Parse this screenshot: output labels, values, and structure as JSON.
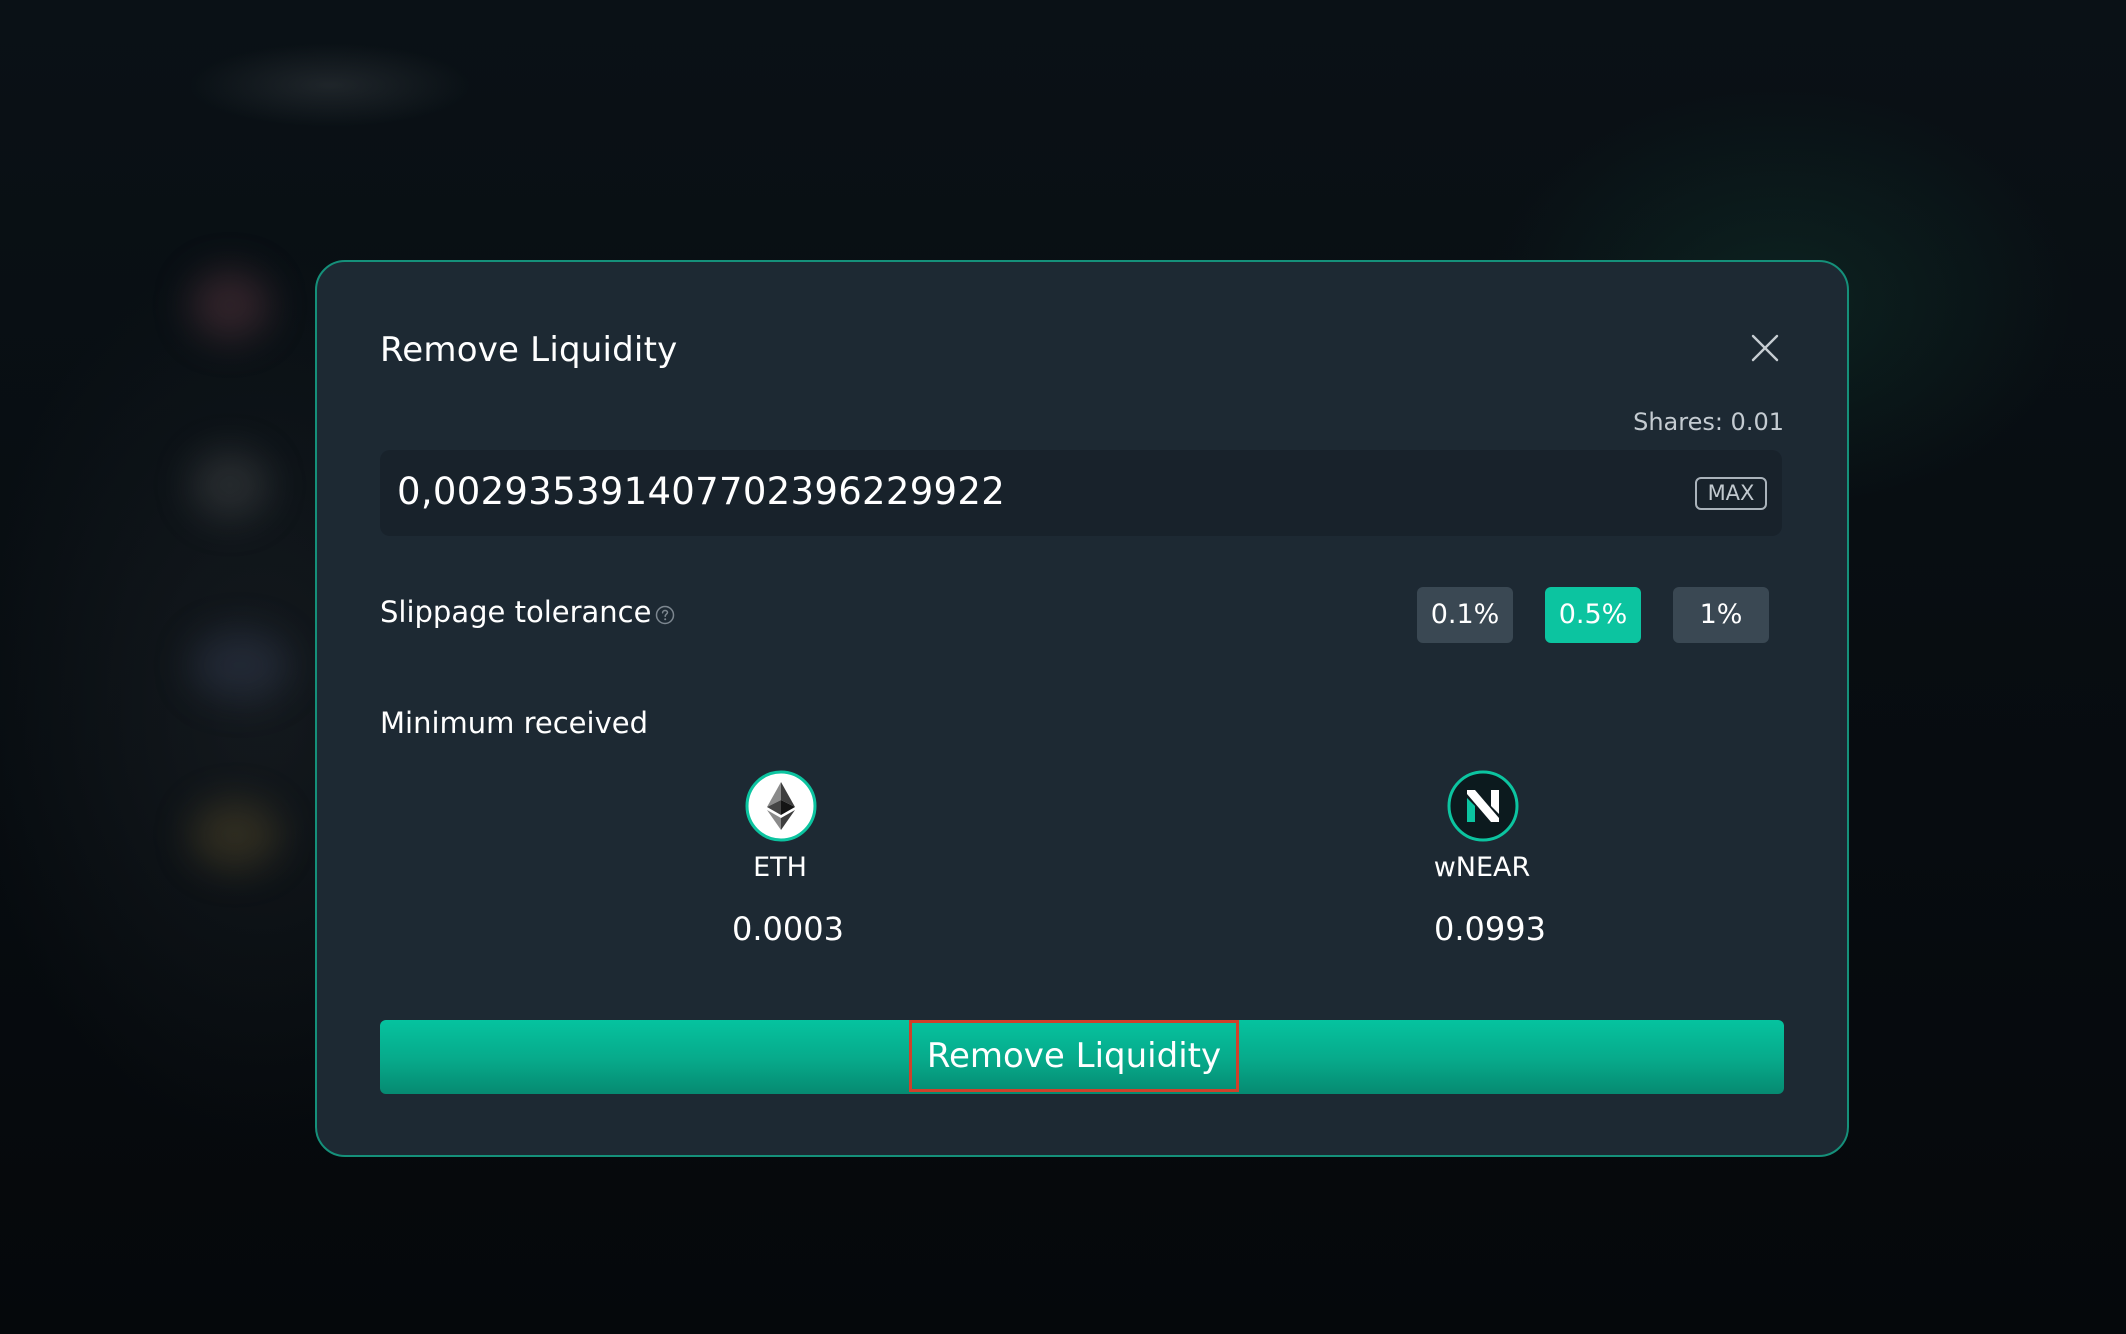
{
  "modal": {
    "title": "Remove Liquidity",
    "shares_text": "Shares: 0.01",
    "amount_input": {
      "value": "0,002935391407702396229922",
      "max_label": "MAX"
    },
    "slippage": {
      "label": "Slippage tolerance",
      "options": [
        "0.1%",
        "0.5%",
        "1%"
      ],
      "selected": "0.5%"
    },
    "minimum_received": {
      "label": "Minimum received",
      "tokens": [
        {
          "symbol": "ETH",
          "amount": "0.0003",
          "icon": "ethereum-icon"
        },
        {
          "symbol": "wNEAR",
          "amount": "0.0993",
          "icon": "near-icon"
        }
      ]
    },
    "submit_label": "Remove Liquidity"
  },
  "colors": {
    "accent": "#0cc4a0",
    "modal_border": "#15907a",
    "modal_bg": "#1d2933",
    "highlight_outline": "#d0402a"
  }
}
